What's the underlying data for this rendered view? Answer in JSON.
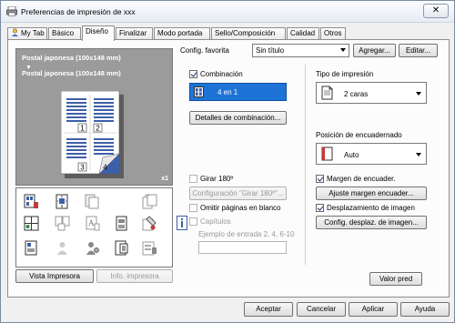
{
  "window": {
    "title": "Preferencias de impresión de xxx",
    "close_glyph": "✕"
  },
  "tabs": [
    {
      "label": "My Tab",
      "icon": "my-tab-icon"
    },
    {
      "label": "Básico"
    },
    {
      "label": "Diseño",
      "active": true
    },
    {
      "label": "Finalizar"
    },
    {
      "label": "Modo portada"
    },
    {
      "label": "Sello/Composición"
    },
    {
      "label": "Calidad"
    },
    {
      "label": "Otros"
    }
  ],
  "preview": {
    "line1": "Postal japonesa (100x148 mm)",
    "arrow": "▼",
    "line2": "Postal japonesa (100x148 mm)",
    "zoom": "x1",
    "page_numbers": [
      "1",
      "2",
      "3",
      "4"
    ]
  },
  "left_buttons": {
    "printer_view": "Vista Impresora",
    "printer_info": "Info. impresora"
  },
  "favorites": {
    "label": "Config. favorita",
    "value": "Sin título",
    "add_button": "Agregar...",
    "edit_button": "Editar..."
  },
  "combination": {
    "checkbox_label": "Combinación",
    "checked": true,
    "value": "4 en 1",
    "details_button": "Detalles de combinación..."
  },
  "rotate": {
    "checkbox_label": "Girar 180º",
    "checked": false,
    "config_button": "Configuración \"Girar 180º\"..."
  },
  "skip_blank": {
    "checkbox_label": "Omitir páginas en blanco",
    "checked": false
  },
  "chapters": {
    "checkbox_label": "Capítulos",
    "checked": false,
    "example": "Ejemplo de entrada 2, 4, 6-10",
    "value": ""
  },
  "print_type": {
    "label": "Tipo de impresión",
    "value": "2 caras"
  },
  "binding_position": {
    "label": "Posición de encuadernado",
    "value": "Auto"
  },
  "binding_margin": {
    "checkbox_label": "Margen de encuader.",
    "checked": true,
    "button": "Ajuste margen encuader..."
  },
  "image_shift": {
    "checkbox_label": "Desplazamiento de imagen",
    "checked": true,
    "button": "Config. desplaz. de imagen..."
  },
  "default_button": "Valor pred",
  "footer": {
    "accept": "Aceptar",
    "cancel": "Cancelar",
    "apply": "Aplicar",
    "help": "Ayuda"
  },
  "colors": {
    "selection_blue": "#1e74d6",
    "preview_gray": "#9b9b9b"
  }
}
